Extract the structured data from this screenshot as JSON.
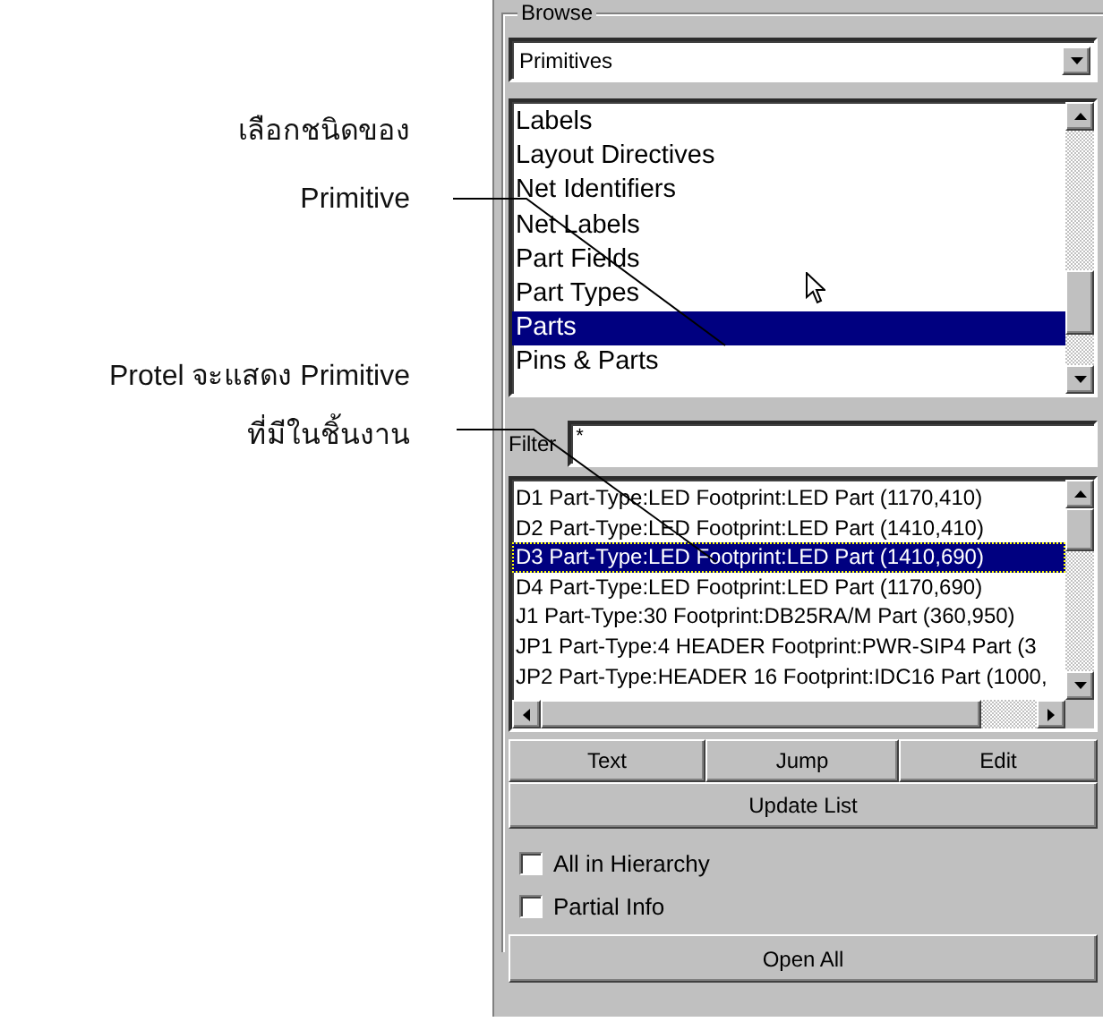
{
  "annotations": [
    {
      "text": "เลือกชนิดของ"
    },
    {
      "text": "Primitive"
    },
    {
      "text": "Protel จะแสดง Primitive"
    },
    {
      "text": "ที่มีในชิ้นงาน"
    }
  ],
  "browse": {
    "title": "Browse",
    "dropdown": {
      "value": "Primitives"
    },
    "types": [
      {
        "label": "Labels",
        "selected": false
      },
      {
        "label": "Layout Directives",
        "selected": false
      },
      {
        "label": "Net Identifiers",
        "selected": false
      },
      {
        "label": "Net Labels",
        "selected": false
      },
      {
        "label": "Part Fields",
        "selected": false
      },
      {
        "label": "Part Types",
        "selected": false
      },
      {
        "label": "Parts",
        "selected": true
      },
      {
        "label": "Pins & Parts",
        "selected": false
      }
    ],
    "filter": {
      "label": "Filter",
      "value": "*"
    },
    "parts": [
      {
        "label": "D1 Part-Type:LED Footprint:LED Part (1170,410)",
        "selected": false
      },
      {
        "label": "D2 Part-Type:LED Footprint:LED Part (1410,410)",
        "selected": false
      },
      {
        "label": "D3 Part-Type:LED Footprint:LED Part (1410,690)",
        "selected": true
      },
      {
        "label": "D4 Part-Type:LED Footprint:LED Part (1170,690)",
        "selected": false
      },
      {
        "label": "J1 Part-Type:30 Footprint:DB25RA/M Part (360,950)",
        "selected": false
      },
      {
        "label": "JP1 Part-Type:4 HEADER Footprint:PWR-SIP4 Part (3",
        "selected": false
      },
      {
        "label": "JP2 Part-Type:HEADER 16 Footprint:IDC16 Part (1000,",
        "selected": false
      }
    ],
    "buttons": [
      "Text",
      "Jump",
      "Edit"
    ],
    "update_button": "Update List",
    "options": [
      {
        "label": "All in Hierarchy",
        "checked": false
      },
      {
        "label": "Partial Info",
        "checked": false
      }
    ],
    "open_button": "Open All"
  }
}
